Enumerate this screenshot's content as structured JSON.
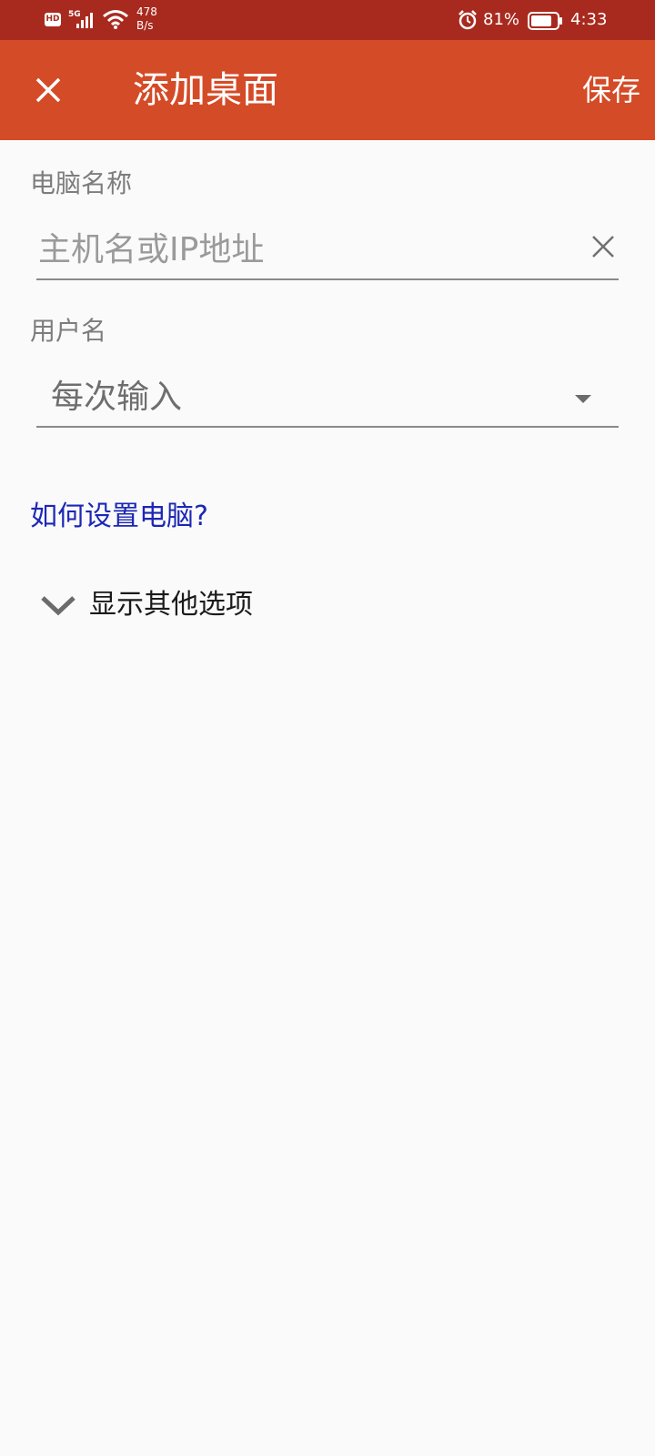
{
  "status_bar": {
    "hd": "HD",
    "network": "5G",
    "speed_value": "478",
    "speed_unit": "B/s",
    "battery_percent": "81%",
    "battery_level": 0.81,
    "time": "4:33"
  },
  "app_bar": {
    "title": "添加桌面",
    "save_label": "保存",
    "background_color": "#d44b27"
  },
  "form": {
    "pc_name_label": "电脑名称",
    "pc_name_placeholder": "主机名或IP地址",
    "username_label": "用户名",
    "username_value": "每次输入"
  },
  "help_link": "如何设置电脑?",
  "more_options_label": "显示其他选项"
}
